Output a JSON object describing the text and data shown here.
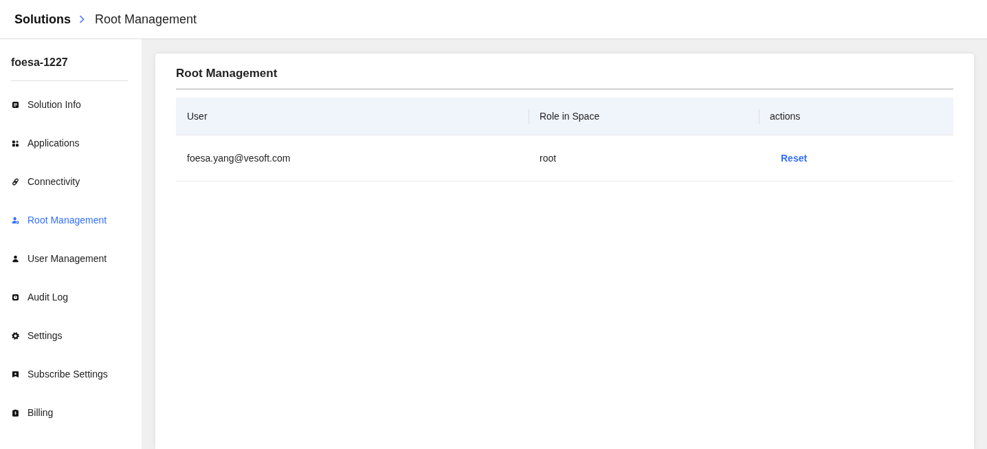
{
  "breadcrumb": {
    "parent": "Solutions",
    "current": "Root Management"
  },
  "sidebar": {
    "title": "foesa-1227",
    "items": [
      {
        "label": "Solution Info",
        "selected": false
      },
      {
        "label": "Applications",
        "selected": false
      },
      {
        "label": "Connectivity",
        "selected": false
      },
      {
        "label": "Root Management",
        "selected": true
      },
      {
        "label": "User Management",
        "selected": false
      },
      {
        "label": "Audit Log",
        "selected": false
      },
      {
        "label": "Settings",
        "selected": false
      },
      {
        "label": "Subscribe Settings",
        "selected": false
      },
      {
        "label": "Billing",
        "selected": false
      }
    ]
  },
  "panel": {
    "title": "Root Management",
    "table": {
      "columns": [
        "User",
        "Role in Space",
        "actions"
      ],
      "rows": [
        {
          "user": "foesa.yang@vesoft.com",
          "role": "root",
          "actions": [
            "Reset"
          ]
        }
      ]
    }
  }
}
